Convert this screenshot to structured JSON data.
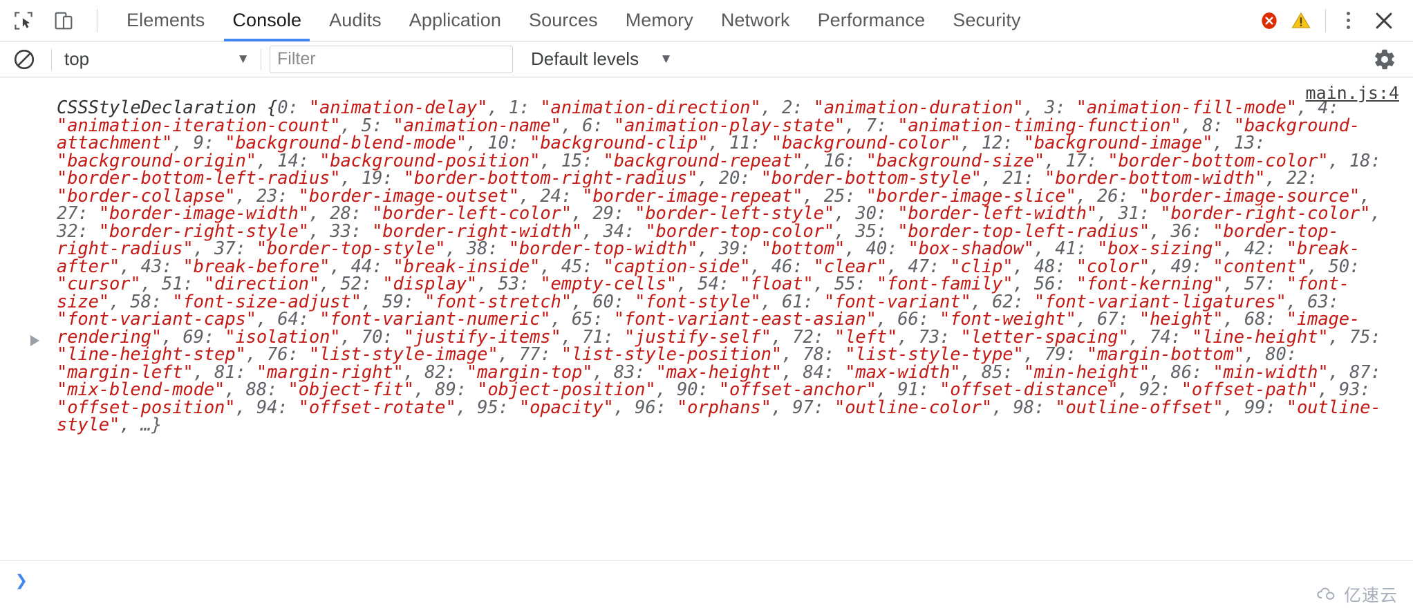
{
  "toolbar": {
    "inspect_icon": "cursor-select-icon",
    "device_icon": "device-toolbar-icon",
    "tabs": [
      {
        "label": "Elements",
        "active": false
      },
      {
        "label": "Console",
        "active": true
      },
      {
        "label": "Audits",
        "active": false
      },
      {
        "label": "Application",
        "active": false
      },
      {
        "label": "Sources",
        "active": false
      },
      {
        "label": "Memory",
        "active": false
      },
      {
        "label": "Network",
        "active": false
      },
      {
        "label": "Performance",
        "active": false
      },
      {
        "label": "Security",
        "active": false
      }
    ],
    "error_badge_icon": "error-circle-icon",
    "warning_badge_icon": "warning-triangle-icon",
    "more_icon": "kebab-menu-icon",
    "close_icon": "close-icon",
    "accent_color": "#4285f4",
    "error_color": "#dd2c00",
    "warning_color": "#f5c518"
  },
  "filter_bar": {
    "clear_icon": "clear-console-icon",
    "context_value": "top",
    "context_caret": "▼",
    "filter_value": "",
    "filter_placeholder": "Filter",
    "levels_value": "Default levels",
    "levels_caret": "▼",
    "settings_icon": "gear-icon"
  },
  "console": {
    "source_link": "main.js:4",
    "expander_icon": "expand-triangle-icon",
    "message": {
      "class_name": "CSSStyleDeclaration ",
      "open_brace": "{",
      "entries": [
        {
          "index": "0",
          "value": "animation-delay"
        },
        {
          "index": "1",
          "value": "animation-direction"
        },
        {
          "index": "2",
          "value": "animation-duration"
        },
        {
          "index": "3",
          "value": "animation-fill-mode"
        },
        {
          "index": "4",
          "value": "animation-iteration-count"
        },
        {
          "index": "5",
          "value": "animation-name"
        },
        {
          "index": "6",
          "value": "animation-play-state"
        },
        {
          "index": "7",
          "value": "animation-timing-function"
        },
        {
          "index": "8",
          "value": "background-attachment"
        },
        {
          "index": "9",
          "value": "background-blend-mode"
        },
        {
          "index": "10",
          "value": "background-clip"
        },
        {
          "index": "11",
          "value": "background-color"
        },
        {
          "index": "12",
          "value": "background-image"
        },
        {
          "index": "13",
          "value": "background-origin"
        },
        {
          "index": "14",
          "value": "background-position"
        },
        {
          "index": "15",
          "value": "background-repeat"
        },
        {
          "index": "16",
          "value": "background-size"
        },
        {
          "index": "17",
          "value": "border-bottom-color"
        },
        {
          "index": "18",
          "value": "border-bottom-left-radius"
        },
        {
          "index": "19",
          "value": "border-bottom-right-radius"
        },
        {
          "index": "20",
          "value": "border-bottom-style"
        },
        {
          "index": "21",
          "value": "border-bottom-width"
        },
        {
          "index": "22",
          "value": "border-collapse"
        },
        {
          "index": "23",
          "value": "border-image-outset"
        },
        {
          "index": "24",
          "value": "border-image-repeat"
        },
        {
          "index": "25",
          "value": "border-image-slice"
        },
        {
          "index": "26",
          "value": "border-image-source"
        },
        {
          "index": "27",
          "value": "border-image-width"
        },
        {
          "index": "28",
          "value": "border-left-color"
        },
        {
          "index": "29",
          "value": "border-left-style"
        },
        {
          "index": "30",
          "value": "border-left-width"
        },
        {
          "index": "31",
          "value": "border-right-color"
        },
        {
          "index": "32",
          "value": "border-right-style"
        },
        {
          "index": "33",
          "value": "border-right-width"
        },
        {
          "index": "34",
          "value": "border-top-color"
        },
        {
          "index": "35",
          "value": "border-top-left-radius"
        },
        {
          "index": "36",
          "value": "border-top-right-radius"
        },
        {
          "index": "37",
          "value": "border-top-style"
        },
        {
          "index": "38",
          "value": "border-top-width"
        },
        {
          "index": "39",
          "value": "bottom"
        },
        {
          "index": "40",
          "value": "box-shadow"
        },
        {
          "index": "41",
          "value": "box-sizing"
        },
        {
          "index": "42",
          "value": "break-after"
        },
        {
          "index": "43",
          "value": "break-before"
        },
        {
          "index": "44",
          "value": "break-inside"
        },
        {
          "index": "45",
          "value": "caption-side"
        },
        {
          "index": "46",
          "value": "clear"
        },
        {
          "index": "47",
          "value": "clip"
        },
        {
          "index": "48",
          "value": "color"
        },
        {
          "index": "49",
          "value": "content"
        },
        {
          "index": "50",
          "value": "cursor"
        },
        {
          "index": "51",
          "value": "direction"
        },
        {
          "index": "52",
          "value": "display"
        },
        {
          "index": "53",
          "value": "empty-cells"
        },
        {
          "index": "54",
          "value": "float"
        },
        {
          "index": "55",
          "value": "font-family"
        },
        {
          "index": "56",
          "value": "font-kerning"
        },
        {
          "index": "57",
          "value": "font-size"
        },
        {
          "index": "58",
          "value": "font-size-adjust"
        },
        {
          "index": "59",
          "value": "font-stretch"
        },
        {
          "index": "60",
          "value": "font-style"
        },
        {
          "index": "61",
          "value": "font-variant"
        },
        {
          "index": "62",
          "value": "font-variant-ligatures"
        },
        {
          "index": "63",
          "value": "font-variant-caps"
        },
        {
          "index": "64",
          "value": "font-variant-numeric"
        },
        {
          "index": "65",
          "value": "font-variant-east-asian"
        },
        {
          "index": "66",
          "value": "font-weight"
        },
        {
          "index": "67",
          "value": "height"
        },
        {
          "index": "68",
          "value": "image-rendering"
        },
        {
          "index": "69",
          "value": "isolation"
        },
        {
          "index": "70",
          "value": "justify-items"
        },
        {
          "index": "71",
          "value": "justify-self"
        },
        {
          "index": "72",
          "value": "left"
        },
        {
          "index": "73",
          "value": "letter-spacing"
        },
        {
          "index": "74",
          "value": "line-height"
        },
        {
          "index": "75",
          "value": "line-height-step"
        },
        {
          "index": "76",
          "value": "list-style-image"
        },
        {
          "index": "77",
          "value": "list-style-position"
        },
        {
          "index": "78",
          "value": "list-style-type"
        },
        {
          "index": "79",
          "value": "margin-bottom"
        },
        {
          "index": "80",
          "value": "margin-left"
        },
        {
          "index": "81",
          "value": "margin-right"
        },
        {
          "index": "82",
          "value": "margin-top"
        },
        {
          "index": "83",
          "value": "max-height"
        },
        {
          "index": "84",
          "value": "max-width"
        },
        {
          "index": "85",
          "value": "min-height"
        },
        {
          "index": "86",
          "value": "min-width"
        },
        {
          "index": "87",
          "value": "mix-blend-mode"
        },
        {
          "index": "88",
          "value": "object-fit"
        },
        {
          "index": "89",
          "value": "object-position"
        },
        {
          "index": "90",
          "value": "offset-anchor"
        },
        {
          "index": "91",
          "value": "offset-distance"
        },
        {
          "index": "92",
          "value": "offset-path"
        },
        {
          "index": "93",
          "value": "offset-position"
        },
        {
          "index": "94",
          "value": "offset-rotate"
        },
        {
          "index": "95",
          "value": "opacity"
        },
        {
          "index": "96",
          "value": "orphans"
        },
        {
          "index": "97",
          "value": "outline-color"
        },
        {
          "index": "98",
          "value": "outline-offset"
        },
        {
          "index": "99",
          "value": "outline-style"
        }
      ],
      "ellipsis": " …}",
      "string_color": "#c41a16",
      "key_color": "#5f6368"
    }
  },
  "prompt": {
    "chevron": "›",
    "input_value": ""
  },
  "watermark": {
    "text": "亿速云",
    "icon": "cloud-icon"
  }
}
